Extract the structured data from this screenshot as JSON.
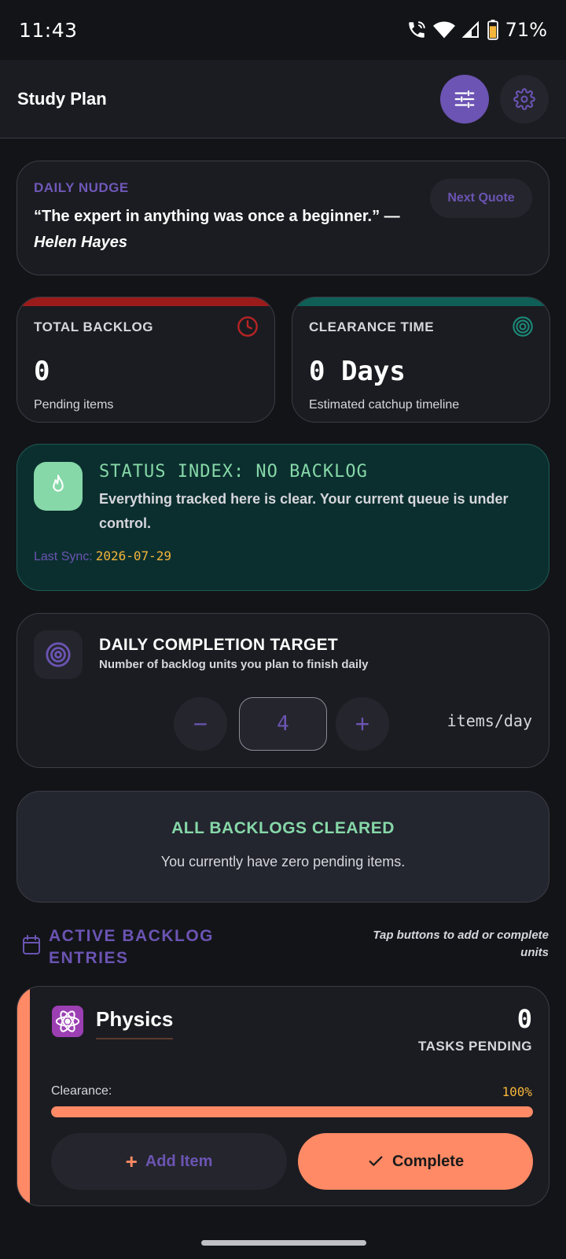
{
  "status_bar": {
    "time": "11:43",
    "battery": "71%"
  },
  "app_bar": {
    "title": "Study Plan"
  },
  "nudge": {
    "label": "DAILY NUDGE",
    "quote": "“The expert in anything was once a beginner.” —",
    "author": "Helen Hayes",
    "next_label": "Next Quote"
  },
  "stats": {
    "backlog": {
      "label": "TOTAL BACKLOG",
      "value": "0",
      "sub": "Pending items",
      "accent": "#9b1b1b"
    },
    "clearance": {
      "label": "CLEARANCE TIME",
      "value": "0 Days",
      "sub": "Estimated catchup timeline",
      "accent": "#0f5f57"
    }
  },
  "status_index": {
    "title": "STATUS INDEX: NO BACKLOG",
    "text": "Everything tracked here is clear. Your current queue is under control.",
    "sync_label": "Last Sync:",
    "sync_value": "2026-07-29"
  },
  "target": {
    "title": "DAILY COMPLETION TARGET",
    "subtitle": "Number of backlog units you plan to finish daily",
    "value": "4",
    "unit": "items/day",
    "minus": "−",
    "plus": "+"
  },
  "cleared": {
    "title": "ALL BACKLOGS CLEARED",
    "subtitle": "You currently have zero pending items."
  },
  "active": {
    "title_line1": "ACTIVE BACKLOG",
    "title_line2": "ENTRIES",
    "hint": "Tap buttons to add or complete units"
  },
  "subject": {
    "name": "Physics",
    "icon": "atom-icon",
    "pending_count": "0",
    "pending_label": "TASKS PENDING",
    "clearance_label": "Clearance:",
    "clearance_value": "100%",
    "clearance_fraction": 1.0,
    "add_label": "Add Item",
    "complete_label": "Complete"
  },
  "colors": {
    "accent_purple": "#6b54b3",
    "mint": "#86d8a8",
    "coral": "#ff8a65",
    "amber": "#f5b53a"
  }
}
